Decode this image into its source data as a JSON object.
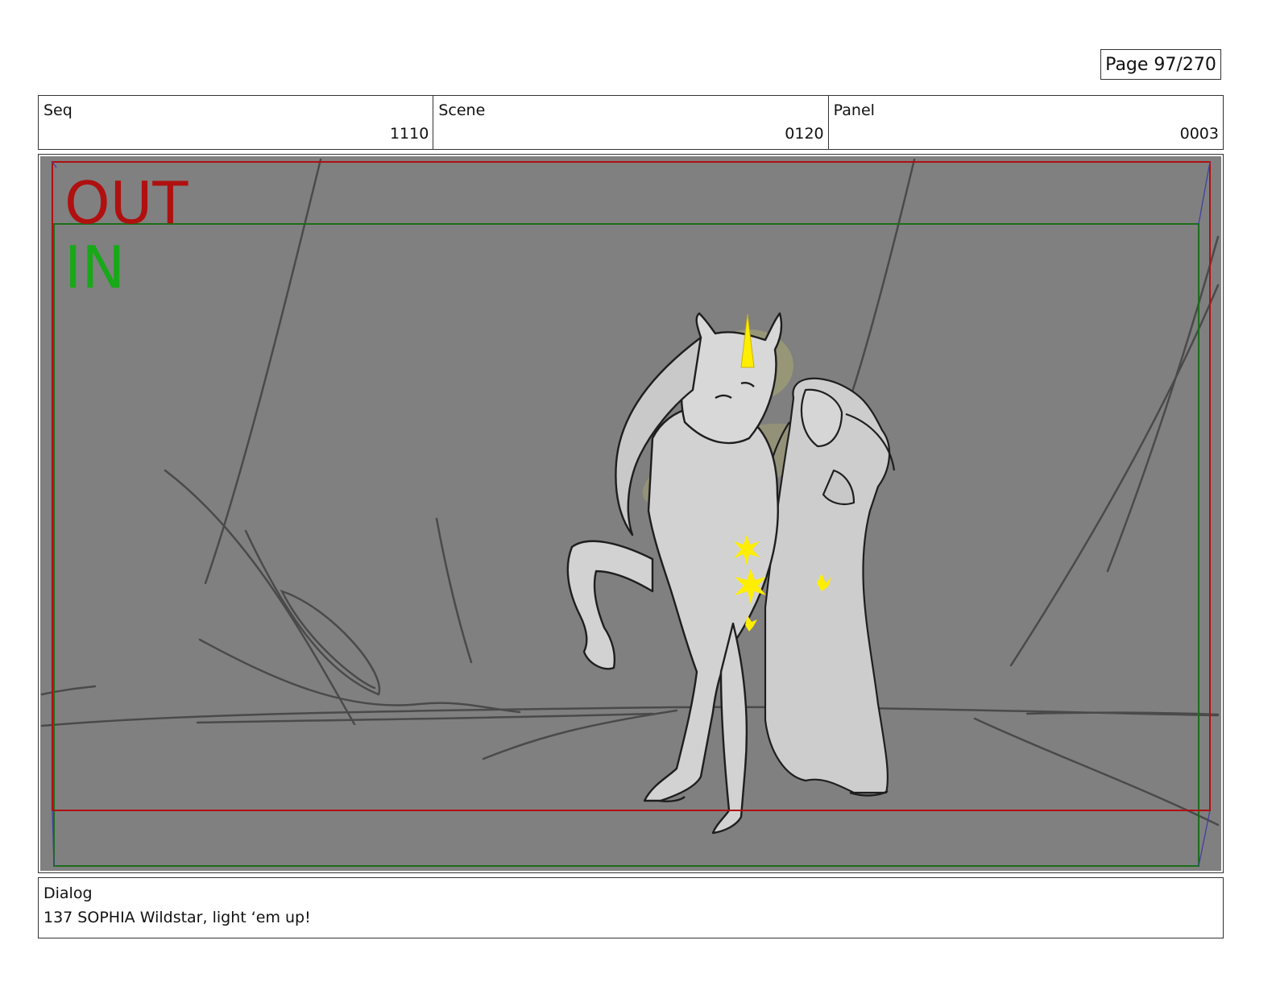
{
  "page_indicator": "Page  97/270",
  "info": {
    "seq_label": "Seq",
    "seq_value": "1110",
    "scene_label": "Scene",
    "scene_value": "0120",
    "panel_label": "Panel",
    "panel_value": "0003"
  },
  "panel": {
    "out_label": "OUT",
    "in_label": "IN",
    "colors": {
      "background": "#808080",
      "out_frame": "#b01010",
      "in_frame": "#1a6e1a",
      "glow": "#ffee00",
      "figure_fill": "#cfcfcf"
    }
  },
  "dialog": {
    "label": "Dialog",
    "text": "137 SOPHIA Wildstar, light ‘em up!"
  }
}
